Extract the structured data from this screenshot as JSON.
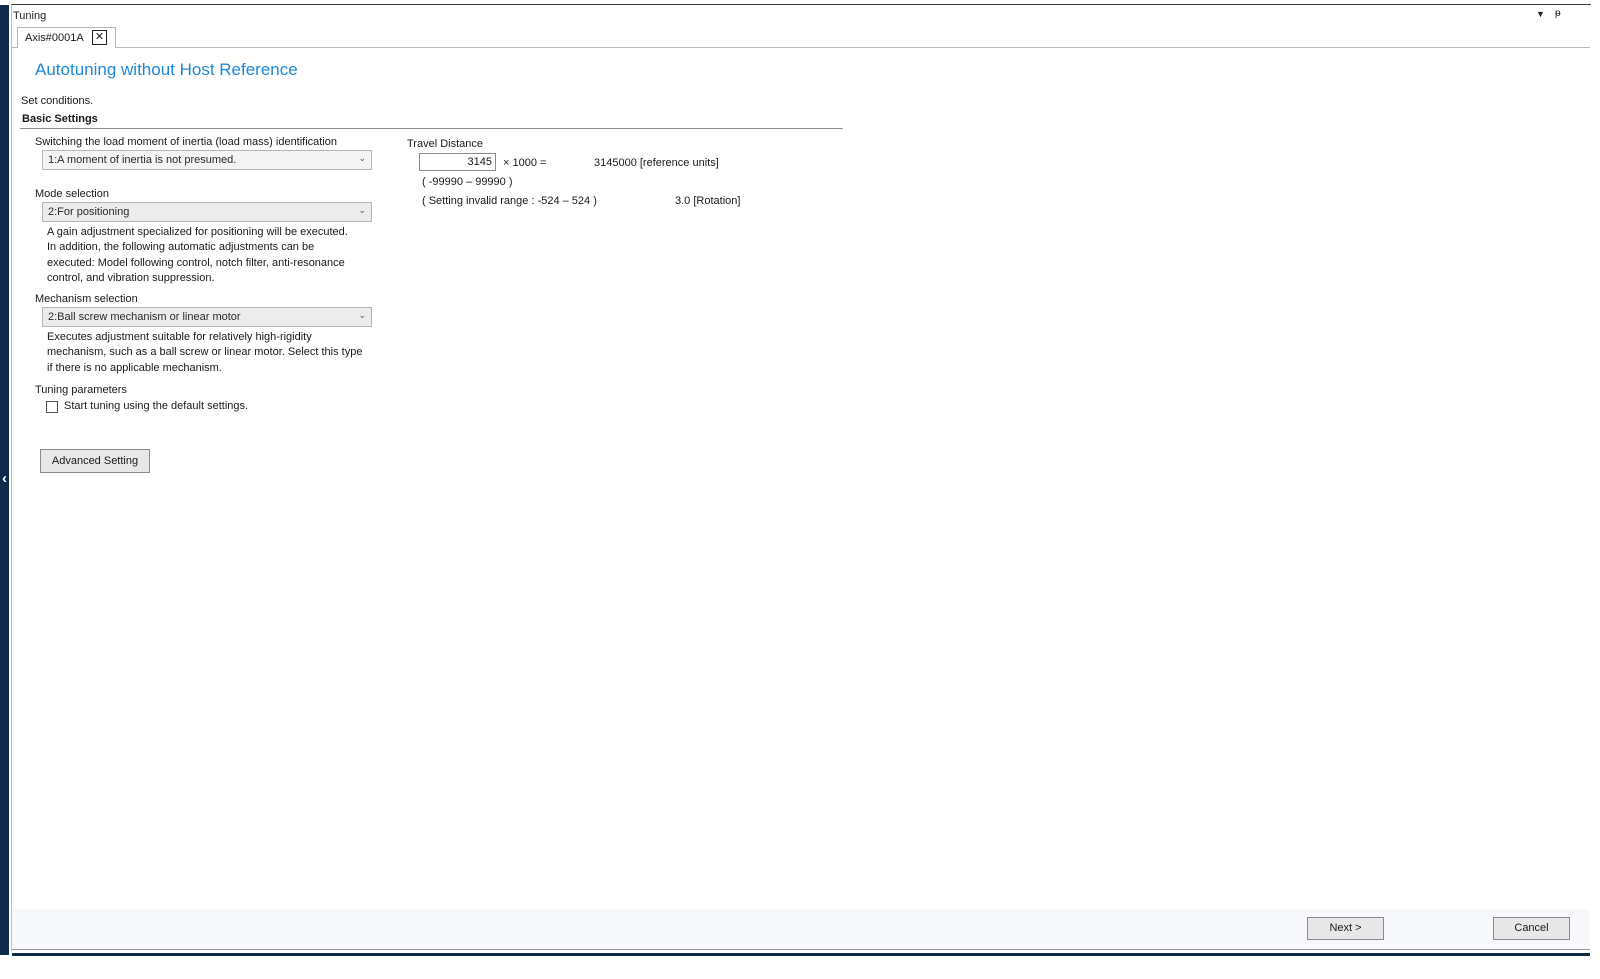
{
  "window": {
    "title": "Tuning",
    "tab_label": "Axis#0001A"
  },
  "page": {
    "heading": "Autotuning without Host Reference",
    "instruction": "Set conditions.",
    "section_title": "Basic Settings"
  },
  "inertia": {
    "label": "Switching the load moment of inertia (load mass) identification",
    "value": "1:A moment of inertia is not presumed."
  },
  "mode": {
    "label": "Mode selection",
    "value": "2:For positioning",
    "description_lines": [
      "A gain adjustment specialized for positioning will be executed.",
      "In addition, the following automatic adjustments can be",
      "executed: Model following control, notch filter, anti-resonance",
      "control, and vibration suppression."
    ]
  },
  "mechanism": {
    "label": "Mechanism selection",
    "value": "2:Ball screw mechanism or linear motor",
    "description_lines": [
      "Executes adjustment suitable for relatively high-rigidity",
      "mechanism, such as a ball screw or linear motor. Select this type",
      "if there is no applicable mechanism."
    ]
  },
  "tuning_params": {
    "label": "Tuning parameters",
    "checkbox_label": "Start tuning using the default settings.",
    "checked": false
  },
  "buttons": {
    "advanced": "Advanced Setting",
    "next": "Next >",
    "cancel": "Cancel"
  },
  "travel": {
    "label": "Travel Distance",
    "input_value": "3145",
    "multiplier": "× 1000 =",
    "result": "3145000 [reference units]",
    "range": "( -99990 – 99990 )",
    "invalid_range": "( Setting invalid range : -524 – 524 )",
    "rotation": "3.0 [Rotation]"
  },
  "icons": {
    "tab_close": "close-icon",
    "title_dropdown": "dropdown-triangle-icon",
    "pin": "pin-icon",
    "side_collapse": "chevron-left-icon",
    "combo_arrow": "chevron-down-icon"
  },
  "colors": {
    "heading": "#1e88d8",
    "side_strip": "#0f2a4a"
  }
}
